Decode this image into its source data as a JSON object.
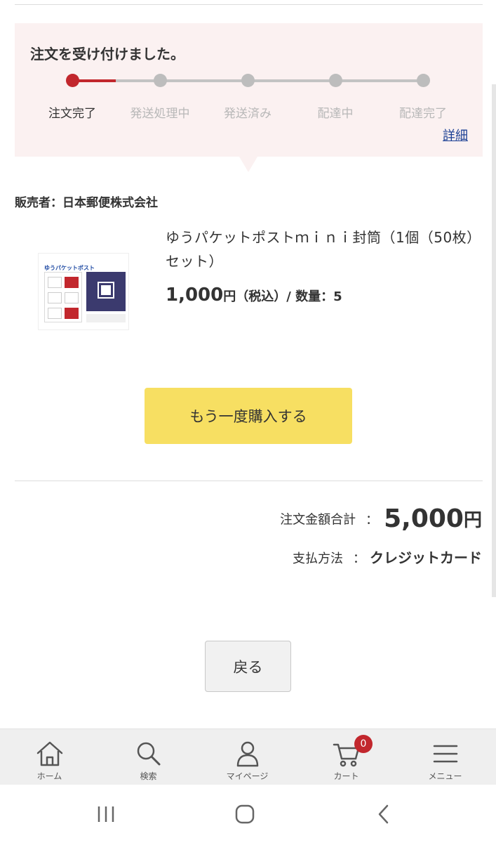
{
  "status": {
    "title": "注文を受け付けました。",
    "current_step_index": 0,
    "steps": [
      "注文完了",
      "発送処理中",
      "発送済み",
      "配達中",
      "配達完了"
    ],
    "detail_link": "詳細"
  },
  "seller": "販売者：日本郵便株式会社",
  "product": {
    "image_alt": "ゆうパケットポスト",
    "name": "ゆうパケットポストｍｉｎｉ封筒（1個（50枚）セット）",
    "price_amount": "1,000",
    "price_suffix": "円（税込）/ 数量：5"
  },
  "rebuy_button": "もう一度購入する",
  "summary": {
    "total_label": "注文金額合計",
    "separator": "：",
    "total_amount": "5,000",
    "total_currency": "円",
    "payment_label": "支払方法",
    "payment_value": "クレジットカード"
  },
  "back_button": "戻る",
  "bottom_nav": {
    "items": [
      {
        "label": "ホーム",
        "icon": "home-icon"
      },
      {
        "label": "検索",
        "icon": "search-icon"
      },
      {
        "label": "マイページ",
        "icon": "user-icon"
      },
      {
        "label": "カート",
        "icon": "cart-icon"
      },
      {
        "label": "メニュー",
        "icon": "menu-icon"
      }
    ],
    "cart_count": "0"
  },
  "system_nav": [
    "recent-apps-icon",
    "home-circle-icon",
    "back-chevron-icon"
  ],
  "colors": {
    "accent_red": "#c2272d",
    "panel_pink": "#fbf1f1",
    "button_yellow": "#f7df62",
    "link_blue": "#1a3f94"
  }
}
